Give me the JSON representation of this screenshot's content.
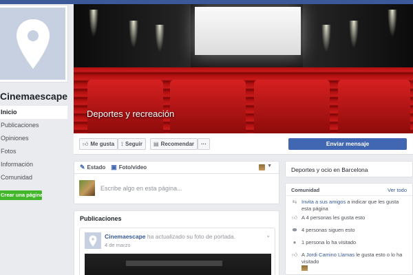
{
  "page": {
    "name": "Cinemaescape",
    "category": "Deportes y recreación",
    "create_page_label": "Crear una página"
  },
  "leftnav": {
    "items": [
      "Inicio",
      "Publicaciones",
      "Opiniones",
      "Fotos",
      "Información",
      "Comunidad"
    ],
    "active_index": 0
  },
  "actions": {
    "like": "Me gusta",
    "follow": "Seguir",
    "recommend": "Recomendar",
    "more": "···",
    "send_message": "Enviar mensaje"
  },
  "composer": {
    "tab_status": "Estado",
    "tab_photo": "Foto/video",
    "placeholder": "Escribe algo en esta página..."
  },
  "publications": {
    "header": "Publicaciones",
    "post": {
      "author": "Cinemaescape",
      "action": "ha actualizado su foto de portada.",
      "date": "4 de marzo"
    }
  },
  "about": {
    "category_location": "Deportes y ocio en Barcelona"
  },
  "community": {
    "header": "Comunidad",
    "see_all": "Ver todo",
    "invite_link": "Invita a sus amigos",
    "invite_rest": "a indicar que les gusta esta página",
    "likes": "A 4 personas les gusta esto",
    "follows": "4 personas siguen esto",
    "visits": "1 persona lo ha visitado",
    "friend_prefix": "A",
    "friend_name": "Jordi Camino Llamas",
    "friend_rest": "le gusta esto o lo ha visitado"
  },
  "colors": {
    "brand": "#3b5998",
    "button_blue": "#4267b2",
    "create_green": "#42b72a",
    "background": "#e9ebee"
  },
  "icons": [
    "map-pin-icon",
    "thumbs-up-icon",
    "rss-icon",
    "recommend-icon",
    "pencil-icon",
    "camera-icon",
    "invite-icon",
    "thumbs-up-small-icon",
    "followers-icon",
    "location-icon"
  ]
}
